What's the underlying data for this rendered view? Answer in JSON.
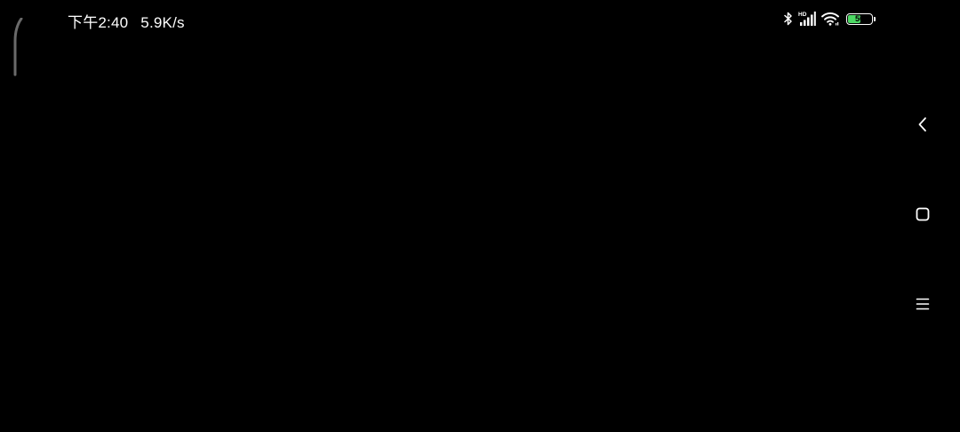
{
  "status_bar": {
    "time": "下午2:40",
    "net_speed": "5.9K/s",
    "network_badge": "HD",
    "battery_level": "56",
    "battery_fraction": 0.56,
    "icons": [
      "bluetooth-icon",
      "signal-icon",
      "wifi-icon",
      "battery-icon"
    ]
  },
  "navigation": {
    "buttons": [
      "back-icon",
      "home-icon",
      "recents-icon"
    ]
  },
  "colors": {
    "background": "#000000",
    "foreground": "#ffffff",
    "battery_fill": "#4cd964"
  }
}
